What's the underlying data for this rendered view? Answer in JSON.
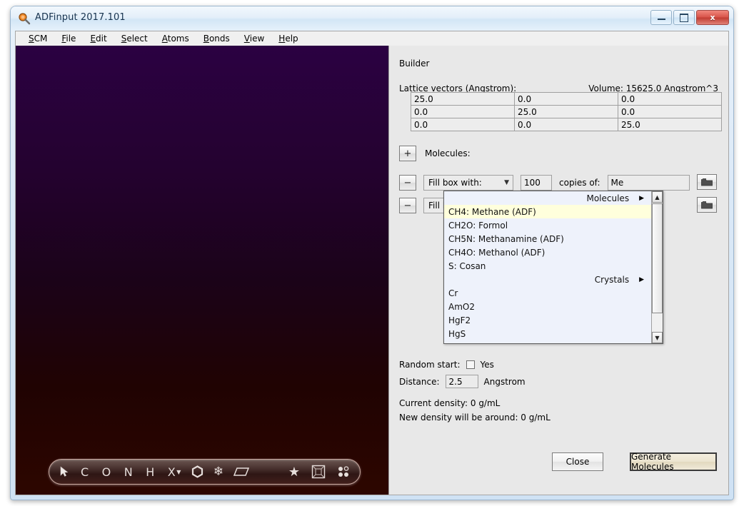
{
  "window": {
    "title": "ADFinput 2017.101",
    "icon": "magnifier-icon",
    "minimize_label": "Minimize",
    "maximize_label": "Maximize",
    "close_label": "x"
  },
  "menubar": {
    "items": [
      {
        "label": "SCM",
        "mnemonic": "S"
      },
      {
        "label": "File",
        "mnemonic": "F"
      },
      {
        "label": "Edit",
        "mnemonic": "E"
      },
      {
        "label": "Select",
        "mnemonic": "S"
      },
      {
        "label": "Atoms",
        "mnemonic": "A"
      },
      {
        "label": "Bonds",
        "mnemonic": "B"
      },
      {
        "label": "View",
        "mnemonic": "V"
      },
      {
        "label": "Help",
        "mnemonic": "H"
      }
    ]
  },
  "viewport": {
    "gradient_top": "#2b0142",
    "gradient_bottom": "#2d0600",
    "toolbar": [
      {
        "name": "select-arrow-tool",
        "glyph": "➤"
      },
      {
        "name": "carbon-atom-tool",
        "glyph": "C"
      },
      {
        "name": "oxygen-atom-tool",
        "glyph": "O"
      },
      {
        "name": "nitrogen-atom-tool",
        "glyph": "N"
      },
      {
        "name": "hydrogen-atom-tool",
        "glyph": "H"
      },
      {
        "name": "other-element-tool",
        "glyph": "X"
      },
      {
        "name": "benzene-ring-tool",
        "glyph": "⬡"
      },
      {
        "name": "snowflake-tool",
        "glyph": "❄"
      },
      {
        "name": "plane-tool",
        "glyph": "▱"
      },
      {
        "name": "star-tool",
        "glyph": "★"
      },
      {
        "name": "periodic-box-tool",
        "glyph": "⧉"
      },
      {
        "name": "dots-tool",
        "glyph": "⁙"
      }
    ]
  },
  "builder": {
    "panel_title": "Builder",
    "lattice_label": "Lattice vectors (Angstrom):",
    "volume_label": "Volume: 15625.0 Angstrom^3",
    "lattice_rows": [
      [
        "25.0",
        "0.0",
        "0.0"
      ],
      [
        "0.0",
        "25.0",
        "0.0"
      ],
      [
        "0.0",
        "0.0",
        "25.0"
      ]
    ],
    "molecules_add_button": "+",
    "molecules_label": "Molecules:",
    "rows": [
      {
        "remove_button": "−",
        "mode": "Fill box with:",
        "count": "100",
        "copies_label": "copies of:",
        "molecule": "Me",
        "browse_icon": "folder-icon"
      },
      {
        "remove_button": "−",
        "mode": "Fill b",
        "count": "",
        "copies_label": "",
        "molecule": "",
        "browse_icon": "folder-icon"
      }
    ],
    "random_start_label": "Random start:",
    "random_start_value": "Yes",
    "random_start_checked": false,
    "distance_label": "Distance:",
    "distance_value": "2.5",
    "distance_unit": "Angstrom",
    "current_density": "Current density: 0 g/mL",
    "new_density": "New density will be around: 0 g/mL",
    "close_button": "Close",
    "generate_button": "Generate Molecules"
  },
  "dropdown": {
    "scroll_up": "▲",
    "scroll_down": "▼",
    "submenu_caret": "▶",
    "entries": [
      {
        "type": "header",
        "label": "Molecules"
      },
      {
        "type": "item",
        "label": "CH4: Methane (ADF)",
        "highlighted": true
      },
      {
        "type": "item",
        "label": "CH2O: Formol",
        "highlighted": false
      },
      {
        "type": "item",
        "label": "CH5N: Methanamine (ADF)",
        "highlighted": false
      },
      {
        "type": "item",
        "label": "CH4O: Methanol (ADF)",
        "highlighted": false
      },
      {
        "type": "item",
        "label": "S: Cosan",
        "highlighted": false
      },
      {
        "type": "header",
        "label": "Crystals"
      },
      {
        "type": "item",
        "label": "Cr",
        "highlighted": false
      },
      {
        "type": "item",
        "label": "AmO2",
        "highlighted": false
      },
      {
        "type": "item",
        "label": "HgF2",
        "highlighted": false
      },
      {
        "type": "item",
        "label": "HgS",
        "highlighted": false
      }
    ]
  }
}
